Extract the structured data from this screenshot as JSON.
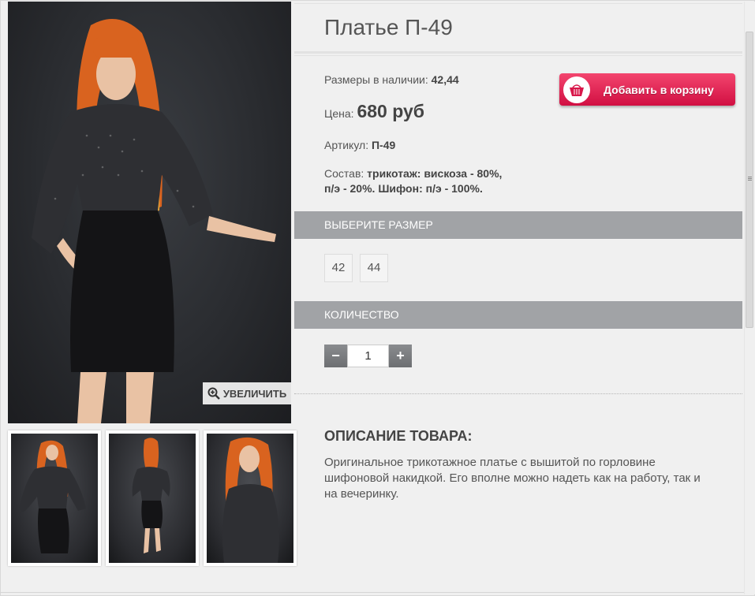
{
  "product": {
    "title": "Платье П-49",
    "sizes_label": "Размеры в наличии:",
    "sizes_value": "42,44",
    "price_label": "Цена:",
    "price_value": "680 руб",
    "article_label": "Артикул:",
    "article_value": "П-49",
    "composition_label": "Состав:",
    "composition_value_1": "трикотаж: вискоза - 80%,",
    "composition_value_2": "п/э - 20%. Шифон: п/э - 100%."
  },
  "cart_button": {
    "label": "Добавить в корзину",
    "icon": "basket-icon",
    "color": "#e0184c"
  },
  "zoom": {
    "label": "УВЕЛИЧИТЬ",
    "icon": "magnifier-plus-icon"
  },
  "size_section": {
    "title": "ВЫБЕРИТЕ РАЗМЕР",
    "options": [
      "42",
      "44"
    ]
  },
  "quantity_section": {
    "title": "КОЛИЧЕСТВО",
    "minus": "−",
    "plus": "+",
    "value": "1"
  },
  "description": {
    "heading": "ОПИСАНИЕ ТОВАРА:",
    "text": "Оригинальное трикотажное платье с вышитой по горловине шифоновой накидкой. Его вполне можно надеть как на работу, так и на вечеринку."
  },
  "colors": {
    "section_bar": "#a1a3a6",
    "background": "#f0f0f0",
    "accent": "#e0184c"
  }
}
